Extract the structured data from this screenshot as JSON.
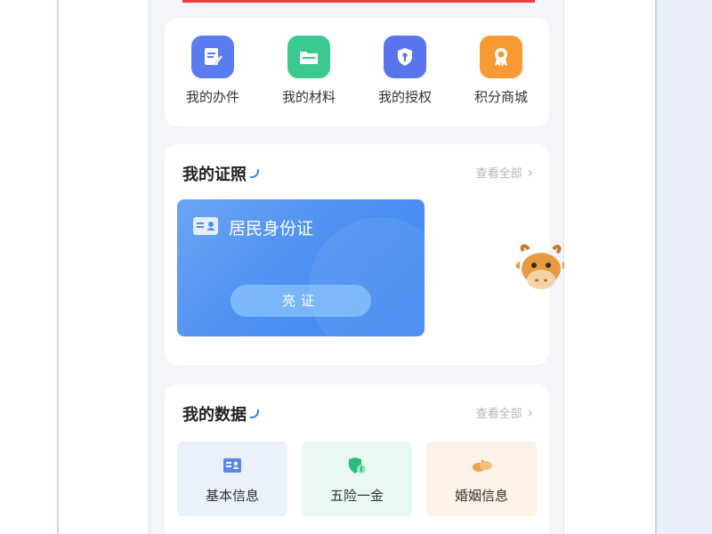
{
  "quick_actions": [
    {
      "label": "我的办件",
      "icon": "document-edit-icon",
      "color": "#5b7cf0"
    },
    {
      "label": "我的材料",
      "icon": "folder-icon",
      "color": "#3cc98f"
    },
    {
      "label": "我的授权",
      "icon": "shield-key-icon",
      "color": "#5a74ee"
    },
    {
      "label": "积分商城",
      "icon": "medal-icon",
      "color": "#f79a34"
    }
  ],
  "licenses": {
    "title": "我的证照",
    "view_all": "查看全部",
    "card": {
      "name": "居民身份证",
      "button": "亮证"
    }
  },
  "my_data": {
    "title": "我的数据",
    "view_all": "查看全部",
    "tiles": [
      {
        "label": "基本信息",
        "icon": "id-card-icon",
        "bg": "#eaf1fd",
        "icon_color": "#5a86e8"
      },
      {
        "label": "五险一金",
        "icon": "shield-icon",
        "bg": "#e9f8f1",
        "icon_color": "#2dbb79"
      },
      {
        "label": "婚姻信息",
        "icon": "rings-icon",
        "bg": "#fdf2e7",
        "icon_color": "#f2a24a"
      }
    ]
  },
  "colors": {
    "accent": "#3a7bf0",
    "alert_bar": "#f04040"
  }
}
